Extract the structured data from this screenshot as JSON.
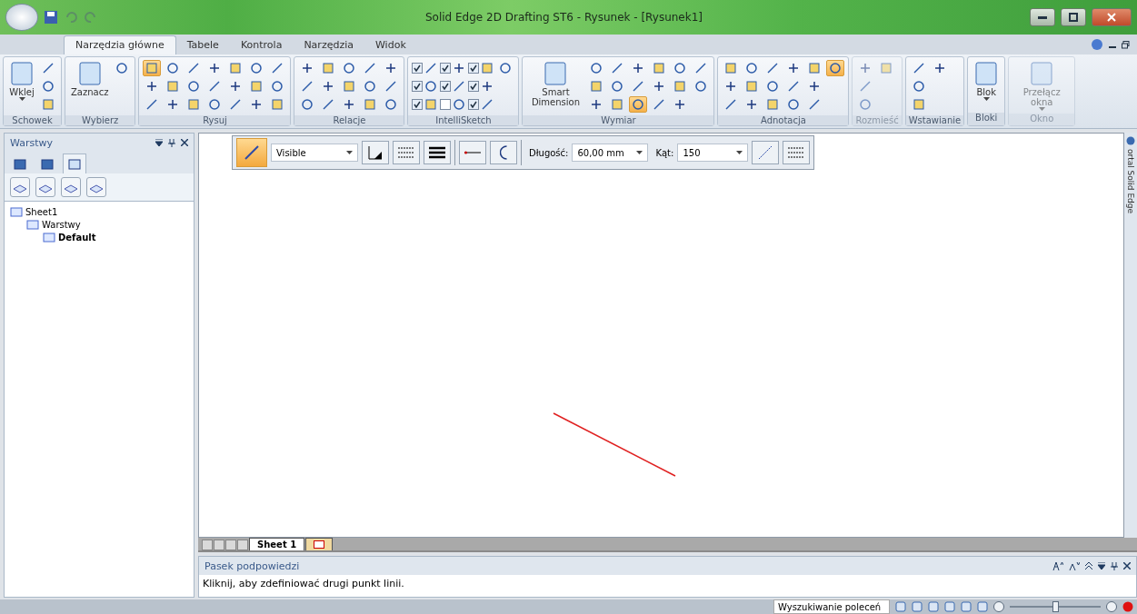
{
  "window": {
    "title": "Solid Edge 2D Drafting ST6 - Rysunek - [Rysunek1]"
  },
  "tabs": [
    {
      "label": "Narzędzia główne",
      "selected": true
    },
    {
      "label": "Tabele",
      "selected": false
    },
    {
      "label": "Kontrola",
      "selected": false
    },
    {
      "label": "Narzędzia",
      "selected": false
    },
    {
      "label": "Widok",
      "selected": false
    }
  ],
  "ribbon": [
    {
      "label": "Schowek",
      "large": [
        {
          "label": "Wklej",
          "dropdown": true
        }
      ],
      "tools": [
        {
          "kind": "tool",
          "selected": false
        },
        {
          "kind": "tool",
          "selected": false
        },
        {
          "kind": "tool",
          "selected": false
        }
      ]
    },
    {
      "label": "Wybierz",
      "large": [
        {
          "label": "Zaznacz"
        }
      ],
      "tools": [
        {
          "kind": "tool",
          "selected": false
        }
      ]
    },
    {
      "label": "Rysuj",
      "tools": [
        {
          "kind": "tool",
          "selected": true
        },
        {
          "kind": "tool",
          "selected": false
        },
        {
          "kind": "tool",
          "selected": false
        },
        {
          "kind": "tool",
          "selected": false
        },
        {
          "kind": "tool",
          "selected": false
        },
        {
          "kind": "tool",
          "selected": false
        },
        {
          "kind": "tool",
          "selected": false
        },
        {
          "kind": "tool",
          "selected": false
        },
        {
          "kind": "tool",
          "selected": false
        },
        {
          "kind": "tool",
          "selected": false
        },
        {
          "kind": "tool",
          "selected": false
        },
        {
          "kind": "tool",
          "selected": false
        },
        {
          "kind": "tool",
          "selected": false
        },
        {
          "kind": "tool",
          "selected": false
        },
        {
          "kind": "tool",
          "selected": false
        },
        {
          "kind": "tool",
          "selected": false
        },
        {
          "kind": "tool",
          "selected": false
        },
        {
          "kind": "tool",
          "selected": false
        },
        {
          "kind": "tool",
          "selected": false
        },
        {
          "kind": "tool",
          "selected": false
        },
        {
          "kind": "tool",
          "selected": false
        }
      ]
    },
    {
      "label": "Relacje",
      "tools": [
        {
          "kind": "tool",
          "selected": false
        },
        {
          "kind": "tool",
          "selected": false
        },
        {
          "kind": "tool",
          "selected": false
        },
        {
          "kind": "tool",
          "selected": false
        },
        {
          "kind": "tool",
          "selected": false
        },
        {
          "kind": "tool",
          "selected": false
        },
        {
          "kind": "tool",
          "selected": false
        },
        {
          "kind": "tool",
          "selected": false
        },
        {
          "kind": "tool",
          "selected": false
        },
        {
          "kind": "tool",
          "selected": false
        },
        {
          "kind": "tool",
          "selected": false
        },
        {
          "kind": "tool",
          "selected": false
        },
        {
          "kind": "tool",
          "selected": false
        },
        {
          "kind": "tool",
          "selected": false
        },
        {
          "kind": "tool",
          "selected": false
        }
      ]
    },
    {
      "label": "IntelliSketch",
      "tools": [
        {
          "kind": "check",
          "checked": true
        },
        {
          "kind": "check",
          "checked": true
        },
        {
          "kind": "check",
          "checked": true
        },
        {
          "kind": "check",
          "checked": true
        },
        {
          "kind": "check",
          "checked": true
        },
        {
          "kind": "check",
          "checked": false
        },
        {
          "kind": "check",
          "checked": true
        },
        {
          "kind": "check",
          "checked": true
        },
        {
          "kind": "check",
          "checked": true
        },
        {
          "kind": "tool",
          "selected": false
        }
      ]
    },
    {
      "label": "Wymiar",
      "large": [
        {
          "label": "Smart Dimension"
        }
      ],
      "tools": [
        {
          "kind": "tool",
          "selected": false
        },
        {
          "kind": "tool",
          "selected": false
        },
        {
          "kind": "tool",
          "selected": false
        },
        {
          "kind": "tool",
          "selected": false
        },
        {
          "kind": "tool",
          "selected": false
        },
        {
          "kind": "tool",
          "selected": false
        },
        {
          "kind": "tool",
          "selected": false
        },
        {
          "kind": "tool",
          "selected": false
        },
        {
          "kind": "tool",
          "selected": true
        },
        {
          "kind": "tool",
          "selected": false
        },
        {
          "kind": "tool",
          "selected": false
        },
        {
          "kind": "tool",
          "selected": false
        },
        {
          "kind": "tool",
          "selected": false
        },
        {
          "kind": "tool",
          "selected": false
        },
        {
          "kind": "tool",
          "selected": false
        },
        {
          "kind": "tool",
          "selected": false
        },
        {
          "kind": "tool",
          "selected": false
        }
      ]
    },
    {
      "label": "Adnotacja",
      "tools": [
        {
          "kind": "tool",
          "selected": false
        },
        {
          "kind": "tool",
          "selected": false
        },
        {
          "kind": "tool",
          "selected": false
        },
        {
          "kind": "tool",
          "selected": false
        },
        {
          "kind": "tool",
          "selected": false
        },
        {
          "kind": "tool",
          "selected": false
        },
        {
          "kind": "tool",
          "selected": false
        },
        {
          "kind": "tool",
          "selected": false
        },
        {
          "kind": "tool",
          "selected": false
        },
        {
          "kind": "tool",
          "selected": false
        },
        {
          "kind": "tool",
          "selected": false
        },
        {
          "kind": "tool",
          "selected": false
        },
        {
          "kind": "tool",
          "selected": false
        },
        {
          "kind": "tool",
          "selected": false
        },
        {
          "kind": "tool",
          "selected": false
        },
        {
          "kind": "tool",
          "selected": true
        }
      ]
    },
    {
      "label": "Rozmieść",
      "disabled": true,
      "tools": [
        {
          "kind": "tool",
          "selected": false
        },
        {
          "kind": "tool",
          "selected": false
        },
        {
          "kind": "tool",
          "selected": false
        },
        {
          "kind": "tool",
          "selected": false
        }
      ]
    },
    {
      "label": "Wstawianie",
      "tools": [
        {
          "kind": "tool",
          "selected": false
        },
        {
          "kind": "tool",
          "selected": false
        },
        {
          "kind": "tool",
          "selected": false
        },
        {
          "kind": "tool",
          "selected": false
        }
      ]
    },
    {
      "label": "Bloki",
      "large": [
        {
          "label": "Blok",
          "dropdown": true
        }
      ]
    },
    {
      "label": "Okno",
      "disabled": true,
      "large": [
        {
          "label": "Przełącz okna",
          "dropdown": true
        }
      ]
    }
  ],
  "layers_panel": {
    "title": "Warstwy",
    "tabs": [
      {
        "selected": false
      },
      {
        "selected": false
      },
      {
        "selected": true
      }
    ],
    "tree": [
      {
        "label": "Sheet1",
        "active": false,
        "children": [
          {
            "label": "Warstwy",
            "active": false,
            "children": [
              {
                "label": "Default",
                "active": true
              }
            ]
          }
        ]
      }
    ]
  },
  "draw_toolbar": {
    "line_type": "Visible",
    "length_label": "Długość:",
    "length": "60,00 mm",
    "angle_label": "Kąt:",
    "angle": "150"
  },
  "side_tab": {
    "label": "ortal Solid Edge"
  },
  "sheet_tabs": [
    {
      "label": "Sheet 1",
      "selected": true
    },
    {
      "selected": false
    }
  ],
  "hint_bar": {
    "title": "Pasek podpowiedzi",
    "text": "Kliknij, aby zdefiniować drugi punkt linii."
  },
  "status_bar": {
    "search_placeholder": "Wyszukiwanie poleceń",
    "zoom": {
      "level": 0.5
    }
  }
}
